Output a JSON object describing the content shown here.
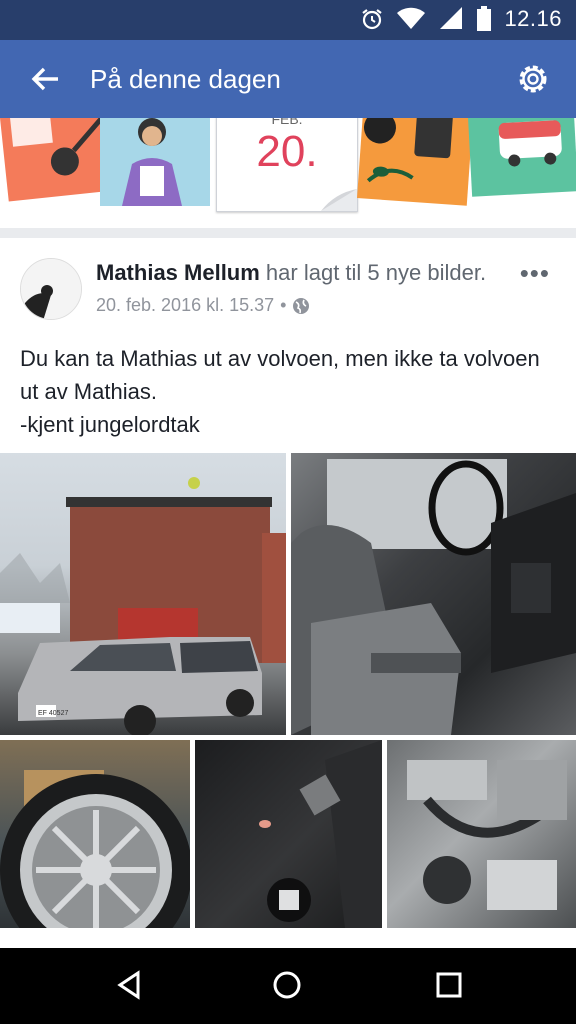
{
  "status_bar": {
    "time": "12.16"
  },
  "app_bar": {
    "title": "På denne dagen"
  },
  "banner": {
    "day": "20.",
    "month_partial": "FEB."
  },
  "post": {
    "author": "Mathias Mellum",
    "action": " har lagt til 5 nye bilder.",
    "timestamp": "20. feb. 2016 kl. 15.37",
    "separator": "•",
    "privacy_icon": "globe-icon",
    "text_lines": [
      "Du kan ta Mathias ut av volvoen, men ikke ta volvoen",
      "ut av Mathias.",
      "-kjent jungelordtak"
    ],
    "photos": [
      {
        "desc": "silver-volvo-estate-photo"
      },
      {
        "desc": "car-interior-photo"
      },
      {
        "desc": "wheel-rim-photo"
      },
      {
        "desc": "gear-shift-photo"
      },
      {
        "desc": "engine-bay-photo"
      }
    ],
    "plate_text": "EF 40527",
    "more_label": "•••"
  },
  "colors": {
    "brand": "#4267b2",
    "status_bar": "#283e6b",
    "accent_date": "#e0425c"
  }
}
